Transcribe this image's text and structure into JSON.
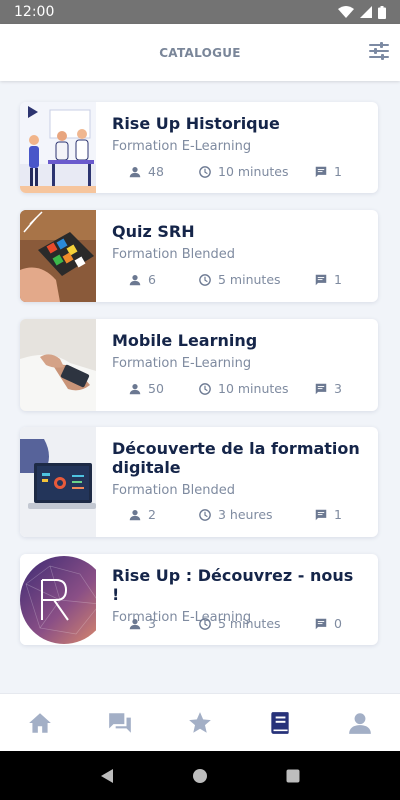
{
  "status_bar": {
    "time": "12:00"
  },
  "header": {
    "title": "CATALOGUE",
    "filter_icon": "sliders-icon"
  },
  "courses": [
    {
      "title": "Rise Up Historique",
      "type": "Formation E-Learning",
      "learners": "48",
      "duration": "10 minutes",
      "comments": "1"
    },
    {
      "title": "Quiz SRH",
      "type": "Formation Blended",
      "learners": "6",
      "duration": "5 minutes",
      "comments": "1"
    },
    {
      "title": "Mobile Learning",
      "type": "Formation E-Learning",
      "learners": "50",
      "duration": "10 minutes",
      "comments": "3"
    },
    {
      "title": "Découverte de la formation digitale",
      "type": "Formation Blended",
      "learners": "2",
      "duration": "3 heures",
      "comments": "1"
    },
    {
      "title": "Rise Up : Découvrez - nous !",
      "type": "Formation E-Learning",
      "learners": "3",
      "duration": "5 minutes",
      "comments": "0"
    }
  ],
  "bottom_nav": {
    "items": [
      "home-icon",
      "chat-icon",
      "star-icon",
      "book-icon",
      "profile-icon"
    ],
    "active_item": "book-icon"
  },
  "colors": {
    "accent": "#27327a",
    "inactive": "#a3afc6",
    "title": "#152549",
    "subtitle": "#7f8ba0"
  }
}
